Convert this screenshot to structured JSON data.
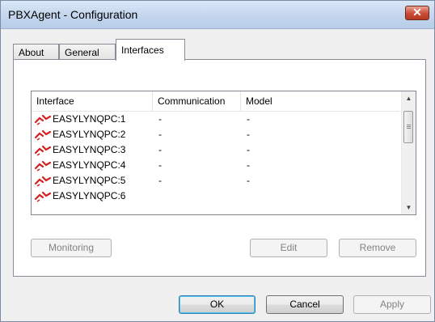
{
  "window": {
    "title": "PBXAgent - Configuration",
    "close_symbol": "✕"
  },
  "tabs": [
    {
      "label": "About"
    },
    {
      "label": "General"
    },
    {
      "label": "Interfaces",
      "selected": true
    }
  ],
  "listview": {
    "columns": [
      "Interface",
      "Communication",
      "Model"
    ],
    "rows": [
      {
        "interface": "EASYLYNQPC:1",
        "communication": "-",
        "model": "-"
      },
      {
        "interface": "EASYLYNQPC:2",
        "communication": "-",
        "model": "-"
      },
      {
        "interface": "EASYLYNQPC:3",
        "communication": "-",
        "model": "-"
      },
      {
        "interface": "EASYLYNQPC:4",
        "communication": "-",
        "model": "-"
      },
      {
        "interface": "EASYLYNQPC:5",
        "communication": "-",
        "model": "-"
      },
      {
        "interface": "EASYLYNQPC:6",
        "communication": "",
        "model": ""
      }
    ],
    "icon": "red-disconnected-plug-icon"
  },
  "panel_buttons": {
    "monitoring": "Monitoring",
    "edit": "Edit",
    "remove": "Remove"
  },
  "dialog_buttons": {
    "ok": "OK",
    "cancel": "Cancel",
    "apply": "Apply"
  },
  "colors": {
    "icon_red": "#d42020",
    "titlebar": "#c5d7ee"
  }
}
